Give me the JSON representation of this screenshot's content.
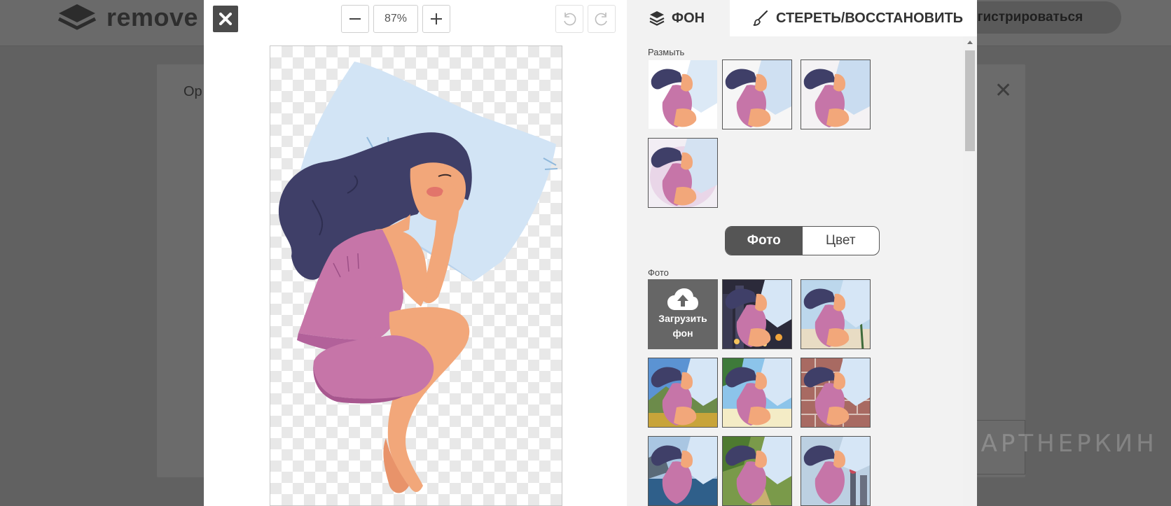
{
  "background_page": {
    "logo_text": "remove",
    "register_label": "егистрироваться",
    "card_text": "Ор"
  },
  "watermark": {
    "text": "ПАРТНЕРКИН"
  },
  "toolbar": {
    "zoom_level": "87%"
  },
  "panel": {
    "tabs": [
      {
        "label": "ФОН",
        "icon": "layers-icon",
        "active": true
      },
      {
        "label": "СТЕРЕТЬ/ВОССТАНОВИТЬ",
        "icon": "brush-icon",
        "active": false
      }
    ],
    "blur_section": {
      "label": "Размыть"
    },
    "toggle": {
      "photo_label": "Фото",
      "color_label": "Цвет",
      "selected": "photo"
    },
    "photo_section": {
      "label": "Фото",
      "upload_label_line1": "Загрузить",
      "upload_label_line2": "фон"
    },
    "photo_backgrounds": [
      "city-night",
      "beach-palms",
      "mountain-valley",
      "tropical-beach",
      "brick-wall",
      "lake-cliffs",
      "forest-path",
      "city-skyline"
    ]
  },
  "colors": {
    "accent_dark": "#555555",
    "hair": "#3f3f68",
    "pajama": "#c675a8",
    "skin": "#f2a77a",
    "pillow": "#d2e4f5"
  }
}
